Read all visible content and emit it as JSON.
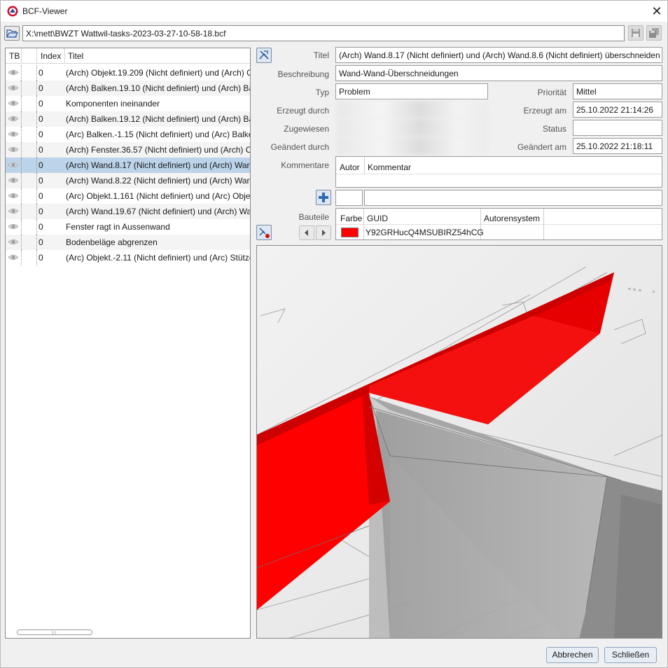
{
  "window": {
    "title": "BCF-Viewer"
  },
  "file": {
    "path": "X:\\mett\\BWZT Wattwil-tasks-2023-03-27-10-58-18.bcf"
  },
  "list": {
    "columns": {
      "tb": "TB",
      "index": "Index",
      "title": "Titel"
    },
    "rows": [
      {
        "index": "0",
        "title": "(Arch) Objekt.19.209 (Nicht definiert) und (Arch) O"
      },
      {
        "index": "0",
        "title": "(Arch) Balken.19.10 (Nicht definiert) und (Arch) Ba"
      },
      {
        "index": "0",
        "title": "Komponenten ineinander"
      },
      {
        "index": "0",
        "title": "(Arch) Balken.19.12 (Nicht definiert) und (Arch) Ba"
      },
      {
        "index": "0",
        "title": "(Arc) Balken.-1.15 (Nicht definiert) und (Arc) Balke"
      },
      {
        "index": "0",
        "title": "(Arch) Fenster.36.57 (Nicht definiert) und (Arch) O"
      },
      {
        "index": "0",
        "title": "(Arch) Wand.8.17 (Nicht definiert) und (Arch) Wan"
      },
      {
        "index": "0",
        "title": "(Arch) Wand.8.22 (Nicht definiert) und (Arch) Wand"
      },
      {
        "index": "0",
        "title": "(Arc) Objekt.1.161 (Nicht definiert) und (Arc) Objel"
      },
      {
        "index": "0",
        "title": "(Arch) Wand.19.67 (Nicht definiert) und (Arch) Wa"
      },
      {
        "index": "0",
        "title": "Fenster ragt in Aussenwand"
      },
      {
        "index": "0",
        "title": "Bodenbeläge abgrenzen"
      },
      {
        "index": "0",
        "title": "(Arc) Objekt.-2.11 (Nicht definiert) und (Arc) Stütze"
      }
    ],
    "selected_row": 6
  },
  "details": {
    "titel_label": "Titel",
    "titel_value": "(Arch) Wand.8.17 (Nicht definiert) und (Arch) Wand.8.6 (Nicht definiert) überschneiden s",
    "beschreibung_label": "Beschreibung",
    "beschreibung_value": "Wand-Wand-Überschneidungen",
    "typ_label": "Typ",
    "typ_value": "Problem",
    "erzeugt_durch_label": "Erzeugt durch",
    "zugewiesen_label": "Zugewiesen",
    "geaendert_durch_label": "Geändert durch",
    "prioritaet_label": "Priorität",
    "prioritaet_value": "Mittel",
    "erzeugt_am_label": "Erzeugt am",
    "erzeugt_am_value": "25.10.2022 21:14:26",
    "status_label": "Status",
    "status_value": "",
    "geaendert_am_label": "Geändert am",
    "geaendert_am_value": "25.10.2022 21:18:11"
  },
  "comments": {
    "label": "Kommentare",
    "col_autor": "Autor",
    "col_kommentar": "Kommentar"
  },
  "components": {
    "label": "Bauteile",
    "col_farbe": "Farbe",
    "col_guid": "GUID",
    "col_autorensystem": "Autorensystem",
    "rows": [
      {
        "color": "#ff0000",
        "guid": "Y92GRHucQ4MSUBIRZ54hCG",
        "autorensystem": ""
      }
    ]
  },
  "buttons": {
    "abbrechen": "Abbrechen",
    "schliessen": "Schließen"
  }
}
